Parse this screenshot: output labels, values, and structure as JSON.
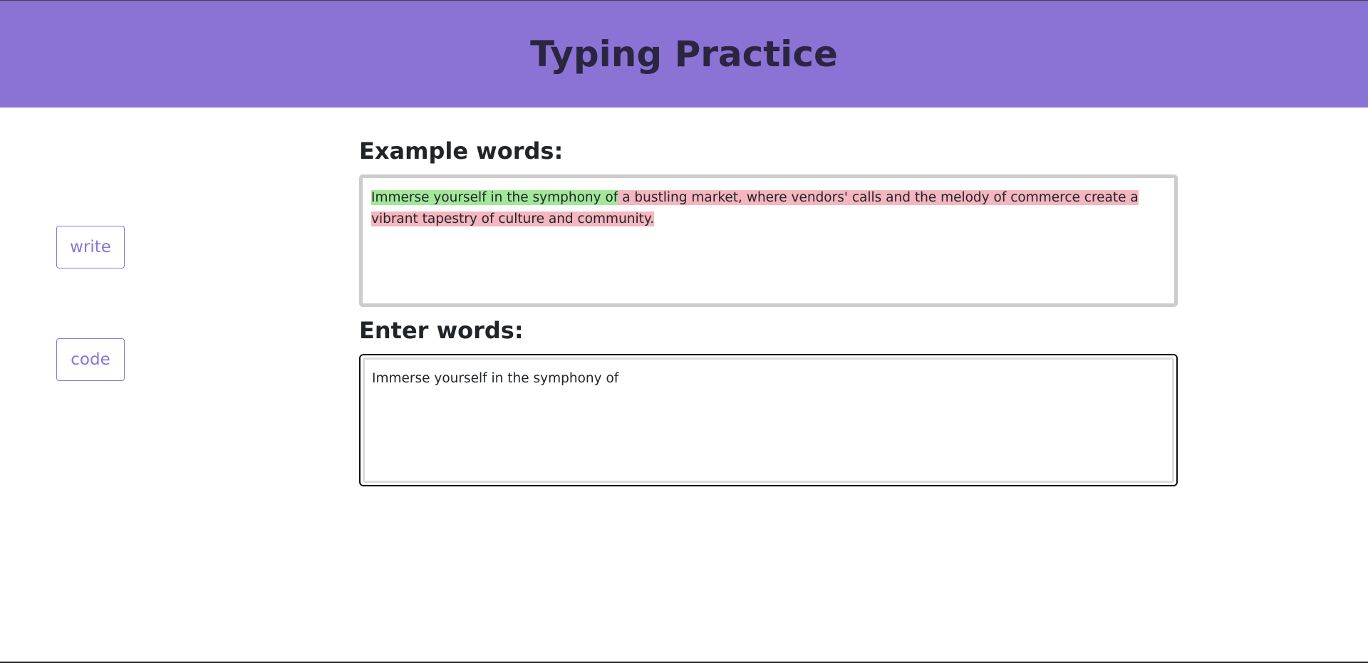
{
  "header": {
    "title": "Typing Practice"
  },
  "sidebar": {
    "write_label": "write",
    "code_label": "code"
  },
  "example": {
    "label": "Example words:",
    "typed_correct": "Immerse yourself in the symphony of",
    "remaining": " a bustling market, where vendors' calls and the melody of commerce create a vibrant tapestry of culture and community."
  },
  "input": {
    "label": "Enter words:",
    "value": "Immerse yourself in the symphony of"
  },
  "colors": {
    "accent": "#8b73d6",
    "correct_highlight": "#a3e89a",
    "pending_highlight": "#f4b6bf"
  }
}
